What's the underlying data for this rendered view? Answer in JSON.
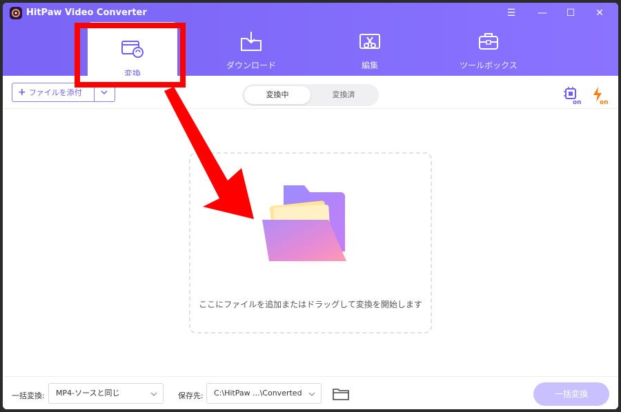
{
  "window": {
    "title": "HitPaw Video Converter",
    "controls": {
      "menu": "☰",
      "minimize": "—",
      "maximize": "☐",
      "close": "✕"
    }
  },
  "nav": {
    "tabs": [
      {
        "label": "変換",
        "active": true,
        "icon": "convert-film-icon"
      },
      {
        "label": "ダウンロード",
        "active": false,
        "icon": "download-folder-icon"
      },
      {
        "label": "編集",
        "active": false,
        "icon": "edit-scissors-icon"
      },
      {
        "label": "ツールボックス",
        "active": false,
        "icon": "toolbox-icon"
      }
    ]
  },
  "toolbar": {
    "add_file_label": "ファイルを添付",
    "segment": {
      "converting": "変換中",
      "converted": "変換済"
    },
    "hw_accel_icon": "cpu-on-icon",
    "speed_icon": "lightning-on-icon",
    "hw_on_text": "on",
    "speed_on_text": "on"
  },
  "main": {
    "drop_hint": "ここにファイルを追加またはドラッグして変換を開始します"
  },
  "footer": {
    "batch_label": "一括変換:",
    "format_value": "MP4-ソースと同じ",
    "save_label": "保存先:",
    "save_path": "C:\\HitPaw ...\\Converted",
    "convert_all_label": "一括変換"
  },
  "colors": {
    "accent": "#7a64f5",
    "annotation": "#ff0000",
    "convert_all_disabled": "#c8c0ff"
  }
}
